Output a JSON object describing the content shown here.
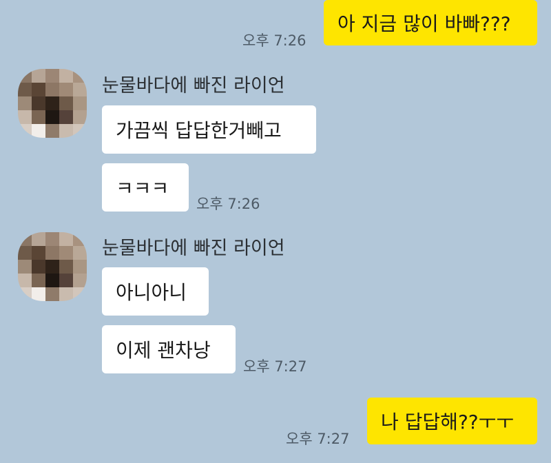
{
  "messages": {
    "m1": {
      "text": "아 지금 많이 바빠???",
      "time": "오후 7:26"
    },
    "sender_name": "눈물바다에 빠진 라이언",
    "m2": {
      "text": "가끔씩 답답한거빼고"
    },
    "m3": {
      "text": "ㅋㅋㅋ",
      "time": "오후 7:26"
    },
    "m4": {
      "text": "아니아니"
    },
    "m5": {
      "text": "이제 괜차낭",
      "time": "오후 7:27"
    },
    "m6": {
      "text": "나 답답해??ㅜㅜ",
      "time": "오후 7:27"
    }
  },
  "colors": {
    "background": "#b2c7d9",
    "my_bubble": "#fee500",
    "other_bubble": "#ffffff"
  },
  "icons": {
    "avatar": "pixelated-profile-avatar"
  }
}
